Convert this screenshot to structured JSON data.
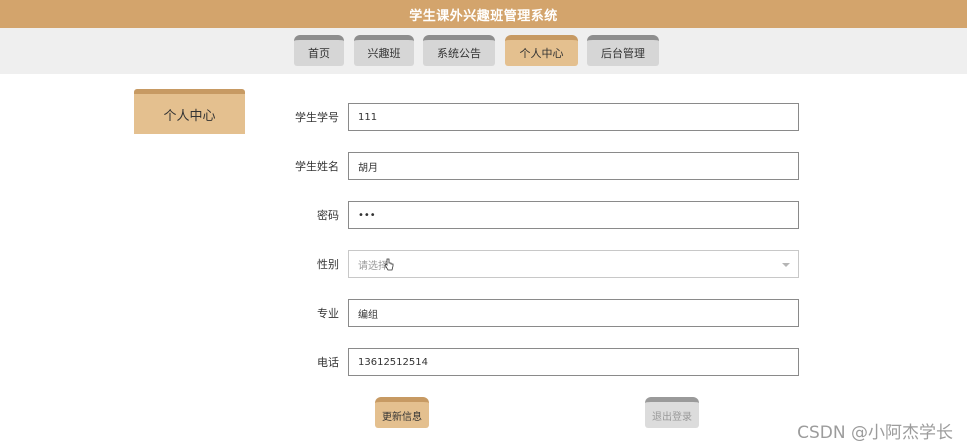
{
  "app": {
    "title": "学生课外兴趣班管理系统"
  },
  "nav": {
    "tabs": [
      {
        "label": "首页"
      },
      {
        "label": "兴趣班"
      },
      {
        "label": "系统公告"
      },
      {
        "label": "个人中心"
      },
      {
        "label": "后台管理"
      }
    ],
    "active": "个人中心"
  },
  "sidebar": {
    "active_label": "个人中心"
  },
  "form": {
    "student_id": {
      "label": "学生学号",
      "value": "111"
    },
    "student_name": {
      "label": "学生姓名",
      "value": "胡月"
    },
    "password": {
      "label": "密码",
      "value": "•••"
    },
    "gender": {
      "label": "性别",
      "placeholder": "请选择"
    },
    "major": {
      "label": "专业",
      "value": "编组"
    },
    "phone": {
      "label": "电话",
      "value": "13612512514"
    }
  },
  "actions": {
    "update_label": "更新信息",
    "logout_label": "退出登录"
  },
  "watermark": {
    "text": "CSDN @小阿杰学长"
  },
  "colors": {
    "header": "#d3a46c",
    "tab_active": "#e4c08f",
    "tab_inactive": "#d6d6d6",
    "nav_background": "#efefef"
  }
}
